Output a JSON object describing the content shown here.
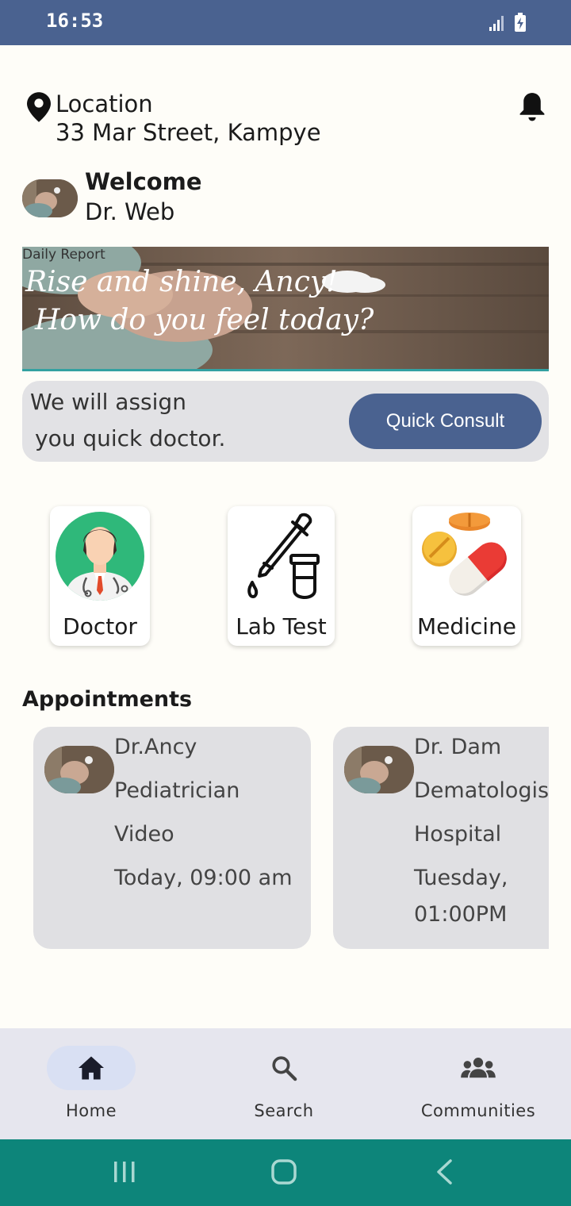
{
  "status_bar": {
    "time": "16:53"
  },
  "location": {
    "label": "Location",
    "address": "33 Mar Street, Kampye"
  },
  "welcome": {
    "title": "Welcome",
    "name": "Dr. Web"
  },
  "banner": {
    "small_label": "Daily Report",
    "line1": "Rise and shine, Ancy!",
    "line2": "How do you feel today?"
  },
  "quick_consult": {
    "text_line1": "We will assign",
    "text_line2": "you quick doctor.",
    "button_label": "Quick Consult"
  },
  "categories": [
    {
      "label": "Doctor"
    },
    {
      "label": "Lab Test"
    },
    {
      "label": "Medicine"
    }
  ],
  "appointments": {
    "title": "Appointments",
    "items": [
      {
        "doctor": "Dr.Ancy",
        "specialty": "Pediatrician",
        "mode": "Video",
        "time": "Today, 09:00 am",
        "time2": ""
      },
      {
        "doctor": "Dr. Dam",
        "specialty": "Dematologist",
        "mode": "Hospital",
        "time": "Tuesday,",
        "time2": "01:00PM"
      }
    ]
  },
  "bottom_nav": {
    "items": [
      {
        "label": "Home",
        "icon": "home-icon",
        "active": true
      },
      {
        "label": "Search",
        "icon": "search-icon",
        "active": false
      },
      {
        "label": "Communities",
        "icon": "groups-icon",
        "active": false
      }
    ]
  },
  "colors": {
    "primary": "#4a6290",
    "background": "#fefdf8",
    "system_bar": "#0d857a",
    "card_gray": "#e0e0e3"
  }
}
